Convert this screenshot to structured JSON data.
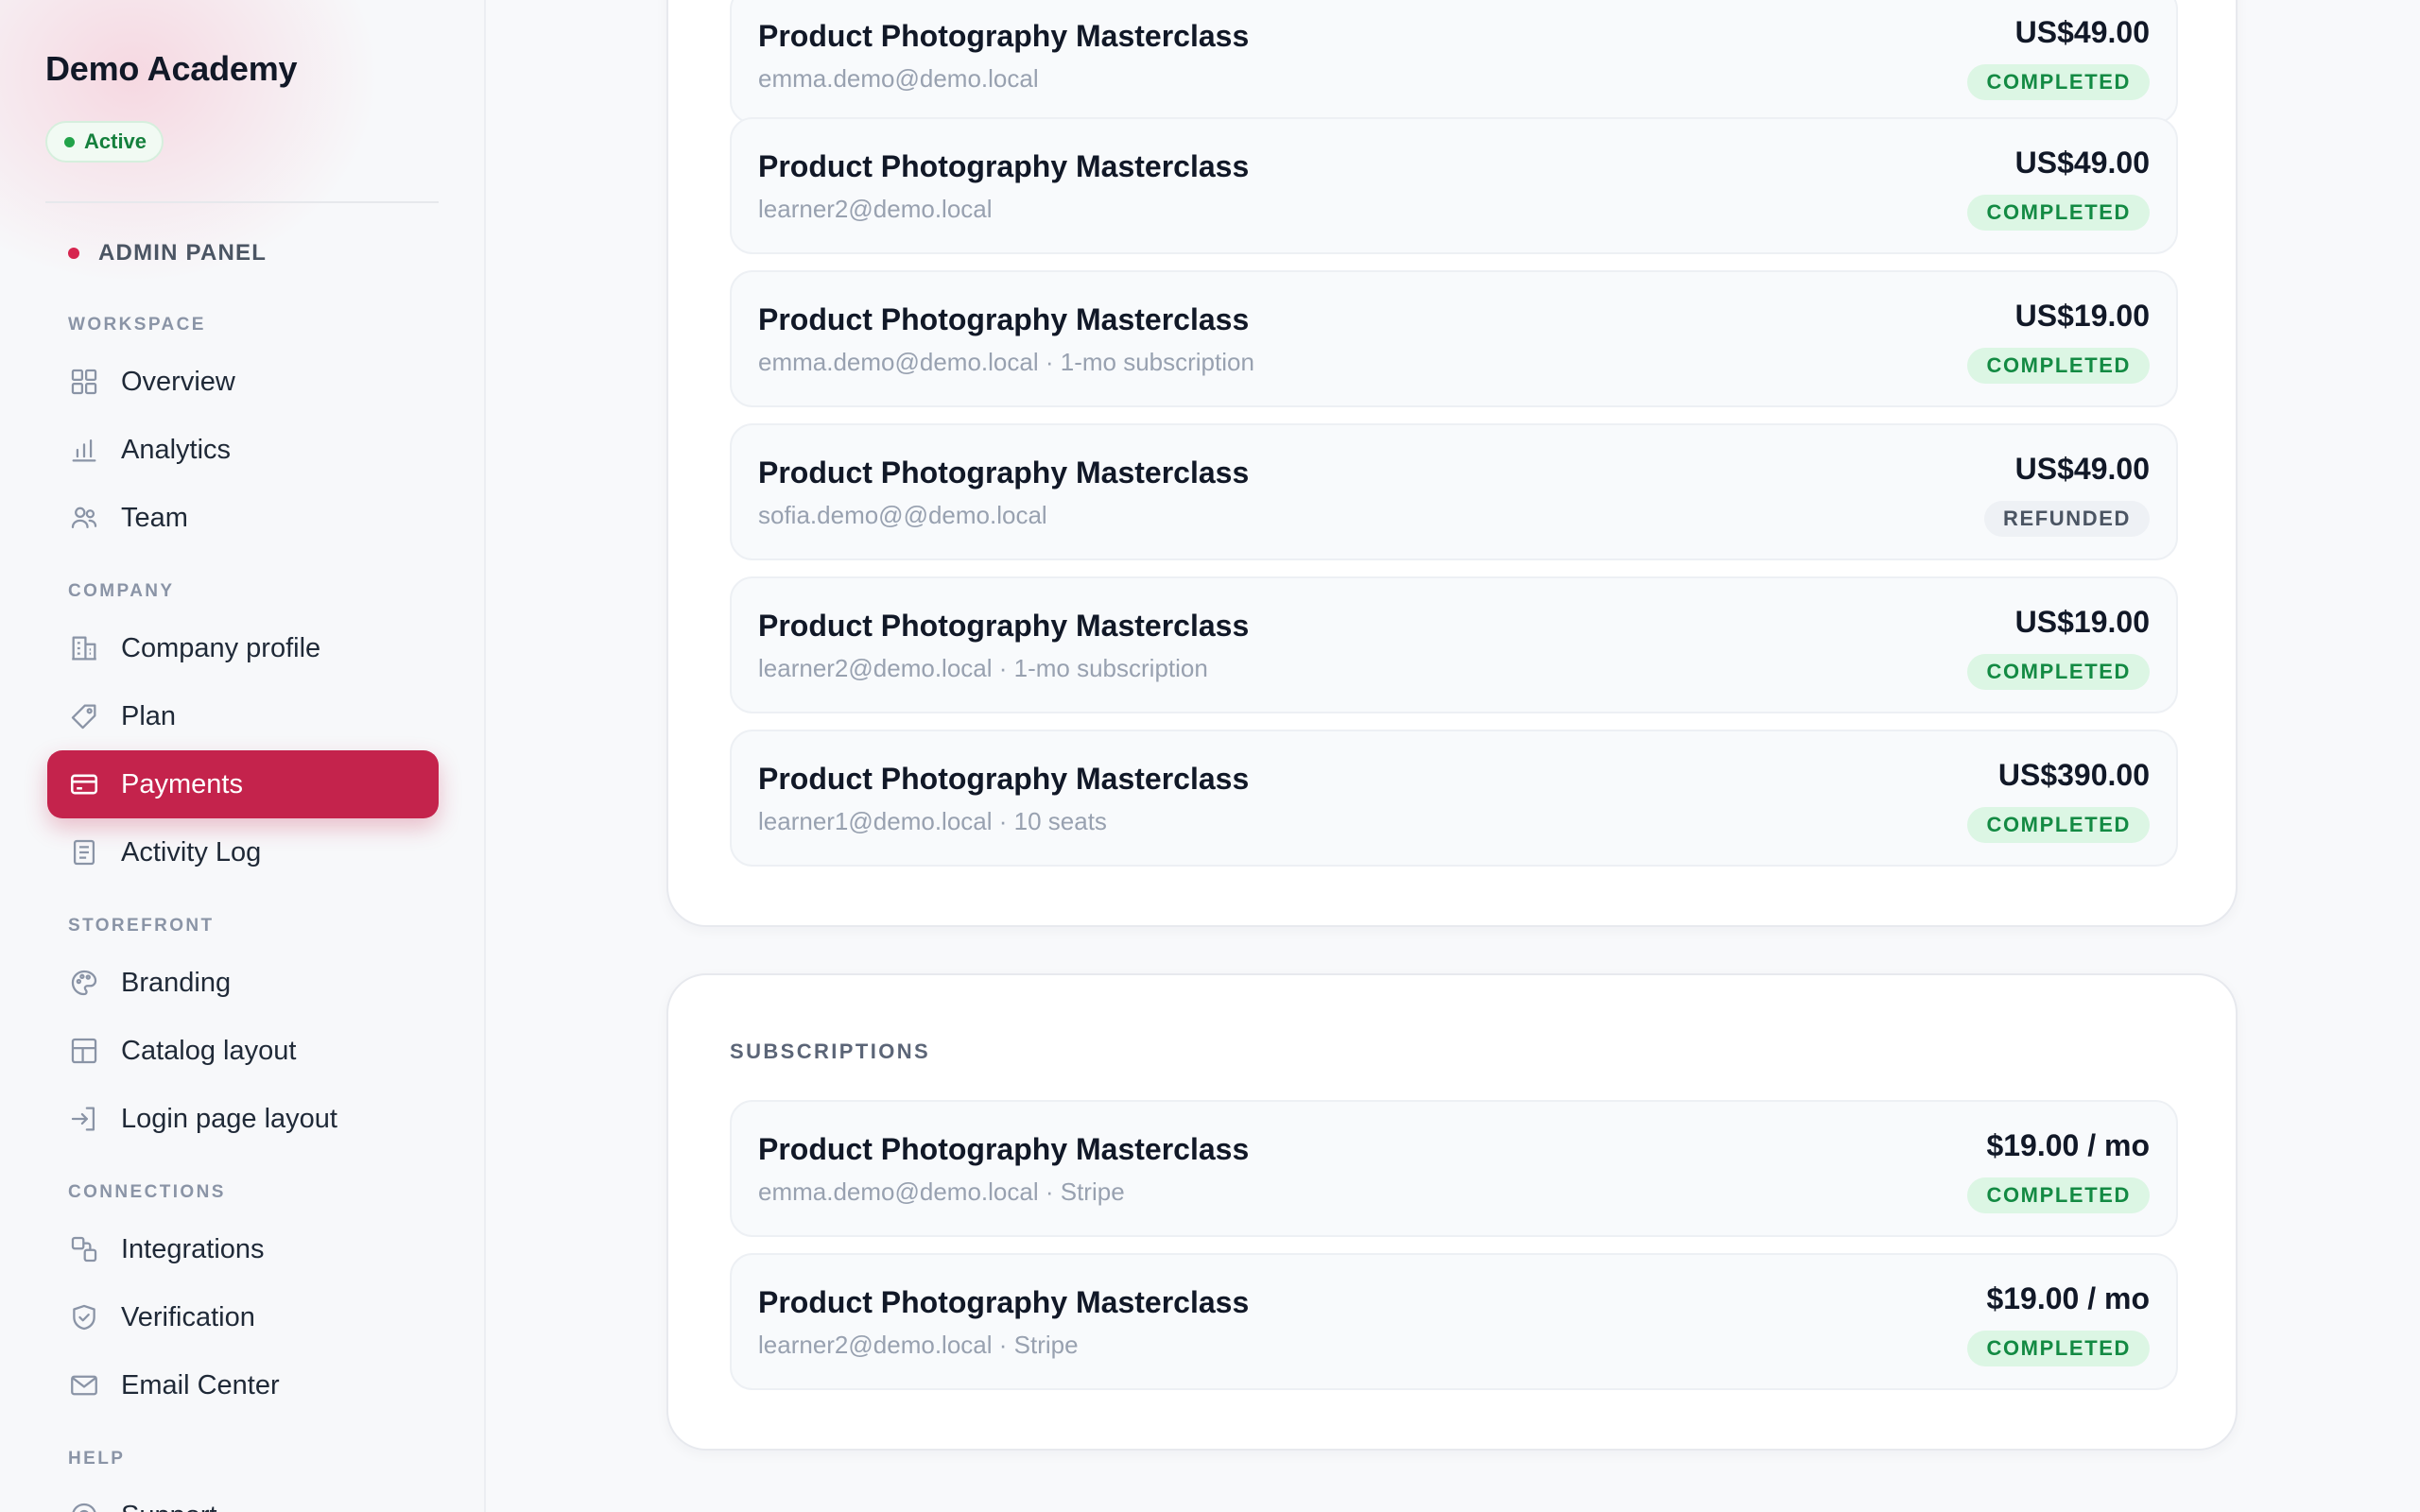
{
  "sidebar": {
    "brand": "Demo Academy",
    "status": "Active",
    "panel_label": "ADMIN PANEL",
    "sections": {
      "workspace": "WORKSPACE",
      "company": "COMPANY",
      "storefront": "STOREFRONT",
      "connections": "CONNECTIONS",
      "help": "HELP"
    },
    "items": {
      "overview": "Overview",
      "analytics": "Analytics",
      "team": "Team",
      "company_profile": "Company profile",
      "plan": "Plan",
      "payments": "Payments",
      "activity_log": "Activity Log",
      "branding": "Branding",
      "catalog_layout": "Catalog layout",
      "login_page_layout": "Login page layout",
      "integrations": "Integrations",
      "verification": "Verification",
      "email_center": "Email Center",
      "support": "Support"
    },
    "active_item": "Payments",
    "colors": {
      "accent": "#c4234c",
      "active_status": "#15803d"
    }
  },
  "payments": {
    "rows": [
      {
        "title": "Product Photography Masterclass",
        "subtitle": "emma.demo@demo.local",
        "amount": "US$49.00",
        "status": "COMPLETED"
      },
      {
        "title": "Product Photography Masterclass",
        "subtitle": "learner2@demo.local",
        "amount": "US$49.00",
        "status": "COMPLETED"
      },
      {
        "title": "Product Photography Masterclass",
        "subtitle": "emma.demo@demo.local · 1-mo subscription",
        "amount": "US$19.00",
        "status": "COMPLETED"
      },
      {
        "title": "Product Photography Masterclass",
        "subtitle": "sofia.demo@@demo.local",
        "amount": "US$49.00",
        "status": "REFUNDED"
      },
      {
        "title": "Product Photography Masterclass",
        "subtitle": "learner2@demo.local · 1-mo subscription",
        "amount": "US$19.00",
        "status": "COMPLETED"
      },
      {
        "title": "Product Photography Masterclass",
        "subtitle": "learner1@demo.local · 10 seats",
        "amount": "US$390.00",
        "status": "COMPLETED"
      }
    ]
  },
  "subscriptions": {
    "heading": "SUBSCRIPTIONS",
    "rows": [
      {
        "title": "Product Photography Masterclass",
        "subtitle": "emma.demo@demo.local · Stripe",
        "amount": "$19.00 / mo",
        "status": "COMPLETED"
      },
      {
        "title": "Product Photography Masterclass",
        "subtitle": "learner2@demo.local · Stripe",
        "amount": "$19.00 / mo",
        "status": "COMPLETED"
      }
    ]
  },
  "status_colors": {
    "completed": "#138a43",
    "refunded": "#4b5563"
  }
}
